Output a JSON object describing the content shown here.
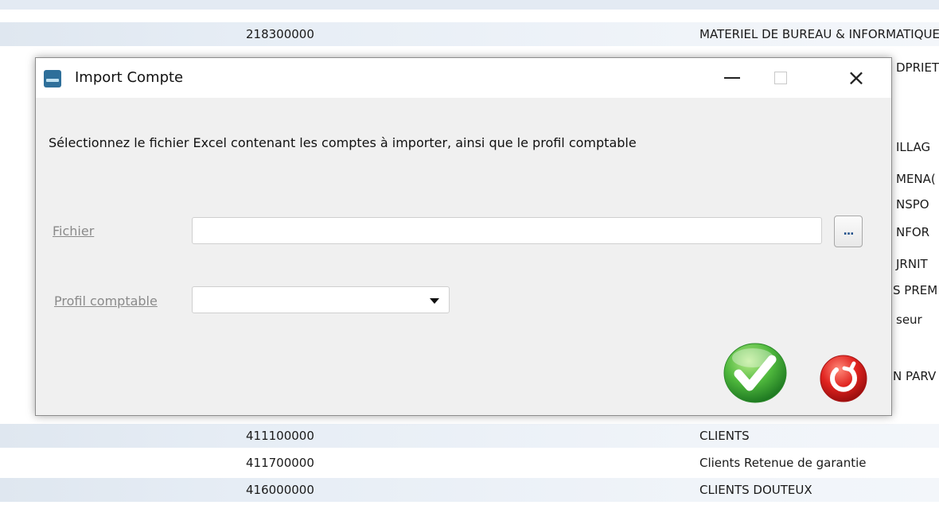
{
  "background": {
    "top_partial": {
      "code": "",
      "label": ""
    },
    "rows_above": [
      {
        "code": "218300000",
        "label": "MATERIEL DE BUREAU & INFORMATIQUE"
      }
    ],
    "right_fragments": [
      "DPRIET",
      "ILLAG",
      "MENA(",
      "NSPO",
      "NFOR",
      "JRNIT",
      "S PREM",
      "seur",
      "N PARV"
    ],
    "rows_below": [
      {
        "code": "411100000",
        "label": "CLIENTS"
      },
      {
        "code": "411700000",
        "label": "Clients Retenue de garantie"
      },
      {
        "code": "416000000",
        "label": "CLIENTS DOUTEUX"
      }
    ]
  },
  "dialog": {
    "title": "Import Compte",
    "instruction": "Sélectionnez le fichier Excel contenant les comptes à importer, ainsi que le profil comptable",
    "file_label": "Fichier",
    "file_value": "",
    "browse_label": "...",
    "profile_label": "Profil comptable",
    "profile_value": ""
  },
  "icons": {
    "app": "app-icon",
    "minimize": "minimize-icon",
    "maximize": "maximize-icon",
    "close": "close-icon",
    "ok": "checkmark-icon",
    "cancel": "power-cancel-icon",
    "dropdown": "chevron-down-icon"
  },
  "colors": {
    "accent_ok": "#3aa63a",
    "accent_cancel": "#e0231f",
    "dialog_bg": "#f0f0f0",
    "stripe": "#e3eaf3"
  }
}
